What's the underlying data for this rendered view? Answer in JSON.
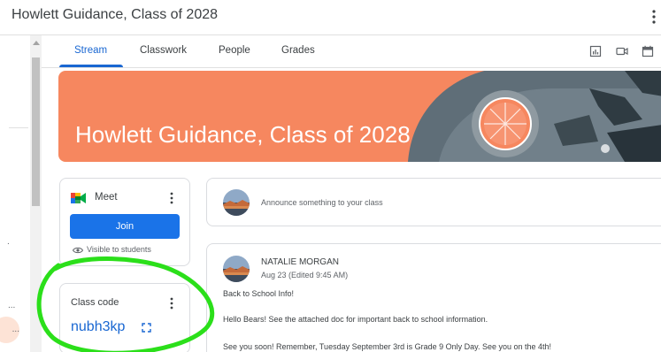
{
  "window": {
    "title": "Howlett Guidance, Class of 2028"
  },
  "tabs": [
    {
      "label": "Stream",
      "active": true
    },
    {
      "label": "Classwork",
      "active": false
    },
    {
      "label": "People",
      "active": false
    },
    {
      "label": "Grades",
      "active": false
    }
  ],
  "toolbar_icons": [
    "report-icon",
    "video-camera-icon",
    "calendar-icon"
  ],
  "banner": {
    "title": "Howlett Guidance, Class of 2028"
  },
  "meet": {
    "label": "Meet",
    "join_label": "Join",
    "visibility": "Visible to students"
  },
  "class_code": {
    "label": "Class code",
    "value": "nubh3kp"
  },
  "announce": {
    "placeholder": "Announce something to your class"
  },
  "post": {
    "author": "NATALIE MORGAN",
    "date": "Aug 23 (Edited 9:45 AM)",
    "lines": [
      "Back to School Info!",
      "Hello Bears!  See the attached doc for important back to school information.",
      "See you soon!  Remember, Tuesday September 3rd is Grade 9 Only Day.  See you on the 4th!"
    ]
  },
  "colors": {
    "accent": "#1967d2",
    "join_button": "#1a73e8",
    "banner": "#f6875f",
    "annotation": "#2bdf1a"
  }
}
